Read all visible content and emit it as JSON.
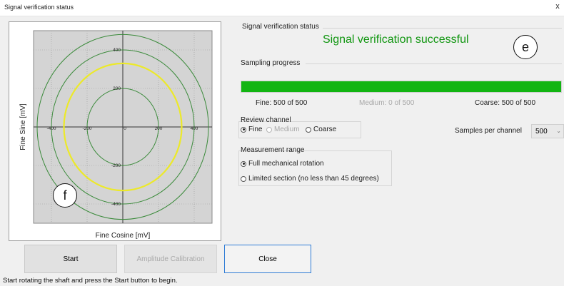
{
  "window": {
    "title": "Signal verification status",
    "close_glyph": "x",
    "close_icon": "close-icon"
  },
  "plot": {
    "x_label": "Fine Cosine [mV]",
    "y_label": "Fine Sine [mV]",
    "x_ticks": [
      "-400",
      "-200",
      "0",
      "200",
      "400"
    ],
    "y_ticks": [
      "400",
      "200",
      "-200",
      "-400"
    ],
    "axis_range": [
      -500,
      500
    ],
    "circle_radii_mv": [
      200,
      400,
      480
    ],
    "signal_radius_mv": 330,
    "colors": {
      "plot_bg": "#d4d4d4",
      "circles": "#3a8a3a",
      "signal": "#ece92a",
      "grid": "#9a9a9a"
    }
  },
  "verification": {
    "group_label": "Signal verification status",
    "message": "Signal verification successful"
  },
  "sampling": {
    "group_label": "Sampling progress",
    "progress_fraction": 1.0,
    "fine": "Fine: 500 of 500",
    "medium": "Medium: 0 of 500",
    "coarse": "Coarse: 500 of 500"
  },
  "review": {
    "group_label": "Review channel",
    "options": [
      "Fine",
      "Medium",
      "Coarse"
    ],
    "selected": "Fine"
  },
  "samples": {
    "label": "Samples per channel",
    "value": "500"
  },
  "range": {
    "group_label": "Measurement range",
    "options": [
      "Full mechanical rotation",
      "Limited section (no less than 45 degrees)"
    ],
    "selected": "Full mechanical rotation"
  },
  "buttons": {
    "start": "Start",
    "amplitude": "Amplitude Calibration",
    "close": "Close"
  },
  "status_bar": "Start rotating the shaft and press the Start button to begin.",
  "markers": {
    "e": "e",
    "f": "f"
  }
}
